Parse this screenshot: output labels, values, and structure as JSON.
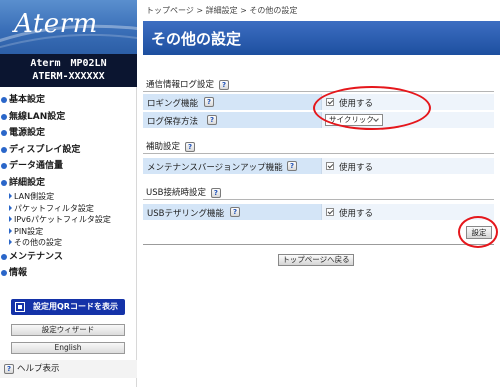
{
  "brand": {
    "logo_text": "Aterm",
    "model_line1": "Aterm　MP02LN",
    "model_line2": "ATERM-XXXXXX"
  },
  "sidebar": {
    "nav": [
      {
        "label": "基本設定",
        "type": "main"
      },
      {
        "label": "無線LAN設定",
        "type": "main"
      },
      {
        "label": "電源設定",
        "type": "main"
      },
      {
        "label": "ディスプレイ設定",
        "type": "main"
      },
      {
        "label": "データ通信量",
        "type": "main"
      },
      {
        "label": "詳細設定",
        "type": "main"
      },
      {
        "label": "LAN側設定",
        "type": "sub"
      },
      {
        "label": "パケットフィルタ設定",
        "type": "sub"
      },
      {
        "label": "IPv6パケットフィルタ設定",
        "type": "sub"
      },
      {
        "label": "PIN設定",
        "type": "sub"
      },
      {
        "label": "その他の設定",
        "type": "sub"
      },
      {
        "label": "メンテナンス",
        "type": "main"
      },
      {
        "label": "情報",
        "type": "main"
      }
    ],
    "qr_button": "設定用QRコードを表示",
    "wizard_button": "設定ウィザード",
    "english_button": "English",
    "help_label": "ヘルプ表示"
  },
  "breadcrumb": "トップページ > 詳細設定 > その他の設定",
  "page_title": "その他の設定",
  "sections": {
    "log": {
      "heading": "通信情報ログ設定",
      "logging_label": "ロギング機能",
      "logging_value": "使用する",
      "save_label": "ログ保存方法",
      "save_value": "サイクリック"
    },
    "assist": {
      "heading": "補助設定",
      "maint_label": "メンテナンスバージョンアップ機能",
      "maint_value": "使用する"
    },
    "usb": {
      "heading": "USB接続時設定",
      "tether_label": "USBテザリング機能",
      "tether_value": "使用する"
    }
  },
  "buttons": {
    "set": "設定",
    "back_to_top": "トップページへ戻る"
  },
  "help_glyph": "?",
  "colors": {
    "title_bar": "#1d4f9f",
    "row_bg": "#d4e5f7",
    "highlight_ring": "#e5171c",
    "qr_button": "#1432a8",
    "nav_bullet": "#2a66c9"
  }
}
